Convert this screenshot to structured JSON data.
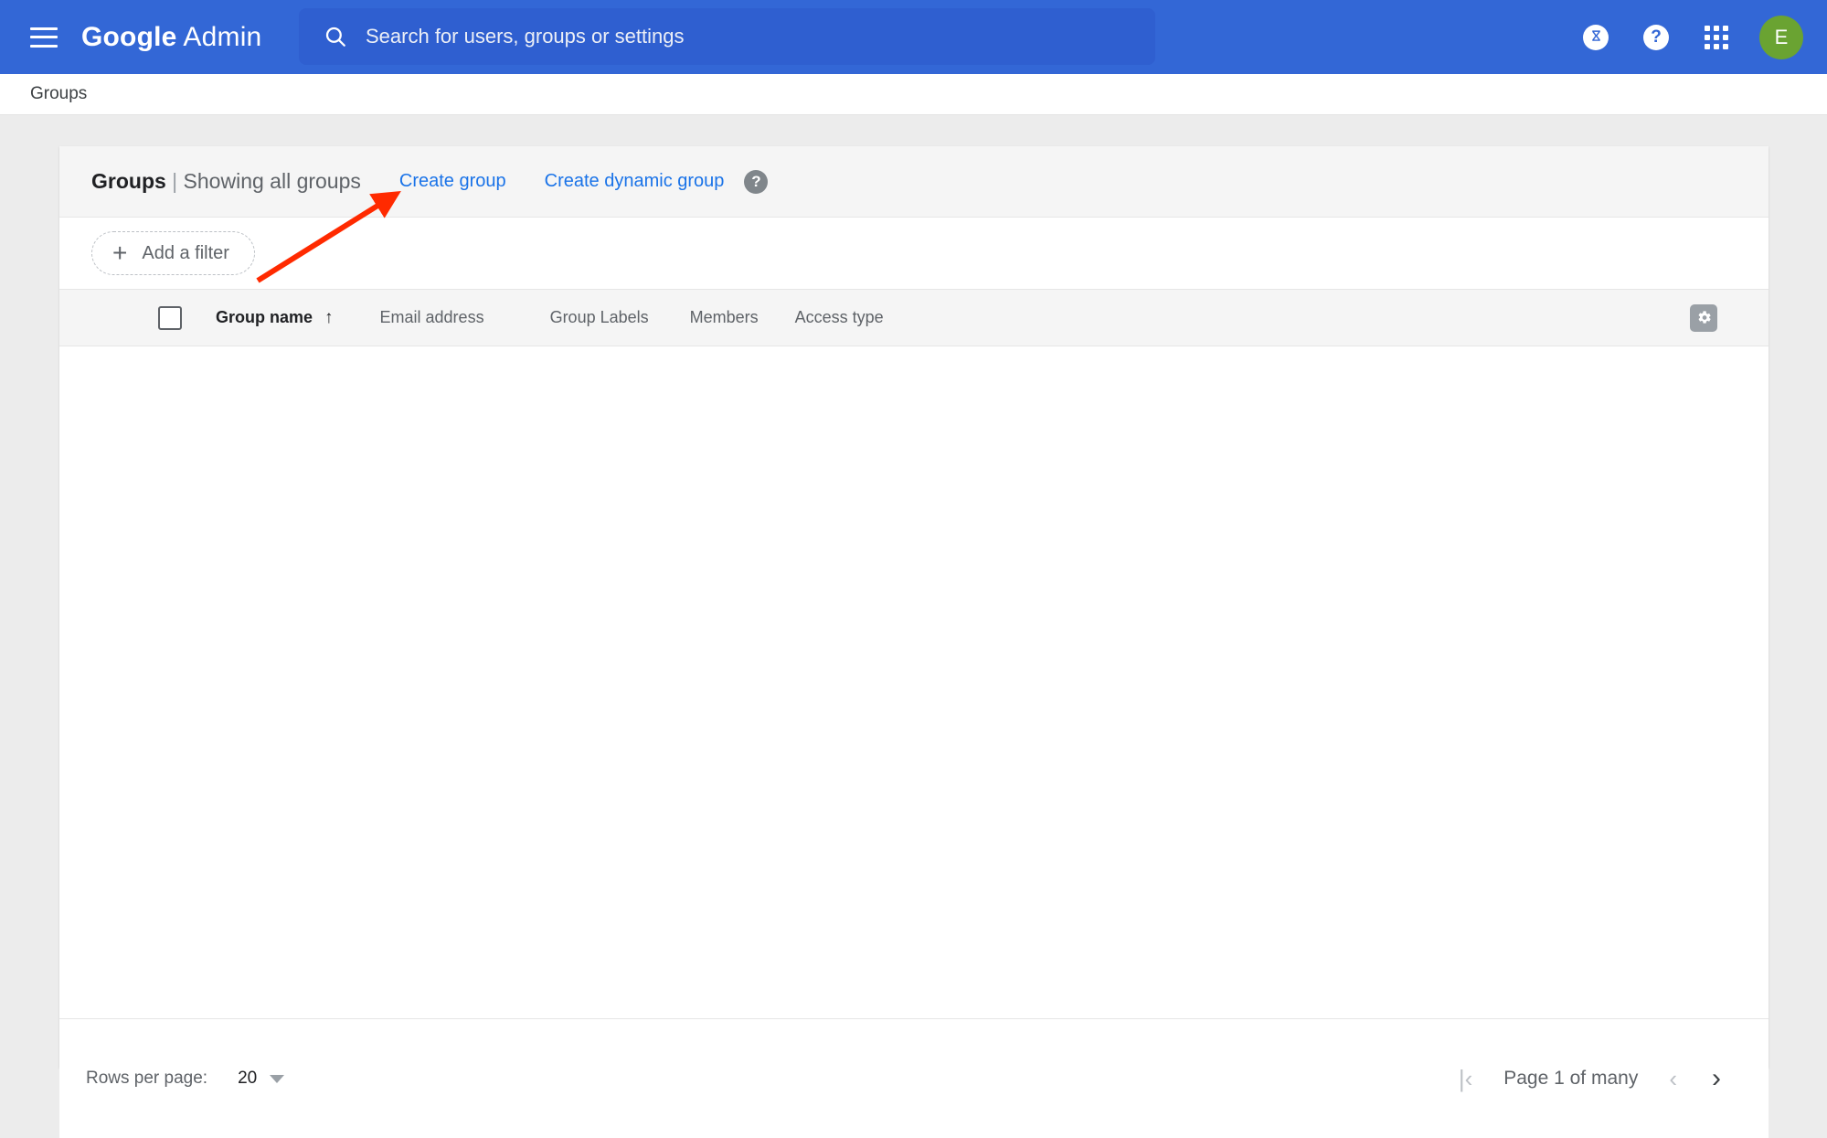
{
  "topbar": {
    "menu_icon": "hamburger-icon",
    "brand_google": "Google",
    "brand_admin": " Admin",
    "search": {
      "icon": "search-icon",
      "placeholder": "Search for users, groups or settings",
      "value": ""
    },
    "hourglass_label": "⌛",
    "help_label": "?",
    "apps_icon": "apps-grid-icon",
    "avatar_initial": "E",
    "colors": {
      "bar": "#3367d6",
      "search_field": "#2f5fd0",
      "avatar": "#6aa332"
    }
  },
  "breadcrumb": {
    "label": "Groups"
  },
  "card": {
    "header": {
      "title_main": "Groups",
      "title_separator": " | ",
      "title_sub": "Showing all groups",
      "create_group_link": "Create group",
      "create_dynamic_group_link": "Create dynamic group",
      "help_icon_label": "?"
    },
    "filter": {
      "plus": "+",
      "label": "Add a filter"
    },
    "table": {
      "select_all_checkbox": "unchecked",
      "columns": [
        {
          "label": "Group name",
          "sorted": true,
          "sort_direction": "↑"
        },
        {
          "label": "Email address",
          "sorted": false
        },
        {
          "label": "Group Labels",
          "sorted": false
        },
        {
          "label": "Members",
          "sorted": false
        },
        {
          "label": "Access type",
          "sorted": false
        }
      ],
      "settings_icon": "gear-icon",
      "rows": []
    },
    "footer": {
      "rows_per_page_label": "Rows per page:",
      "rows_per_page_value": "20",
      "first_page_label": "|‹",
      "page_text": "Page 1 of many",
      "prev_label": "‹",
      "next_label": "›"
    }
  },
  "annotation": {
    "arrow_color": "#ff2a00",
    "points_to": "Create group"
  }
}
